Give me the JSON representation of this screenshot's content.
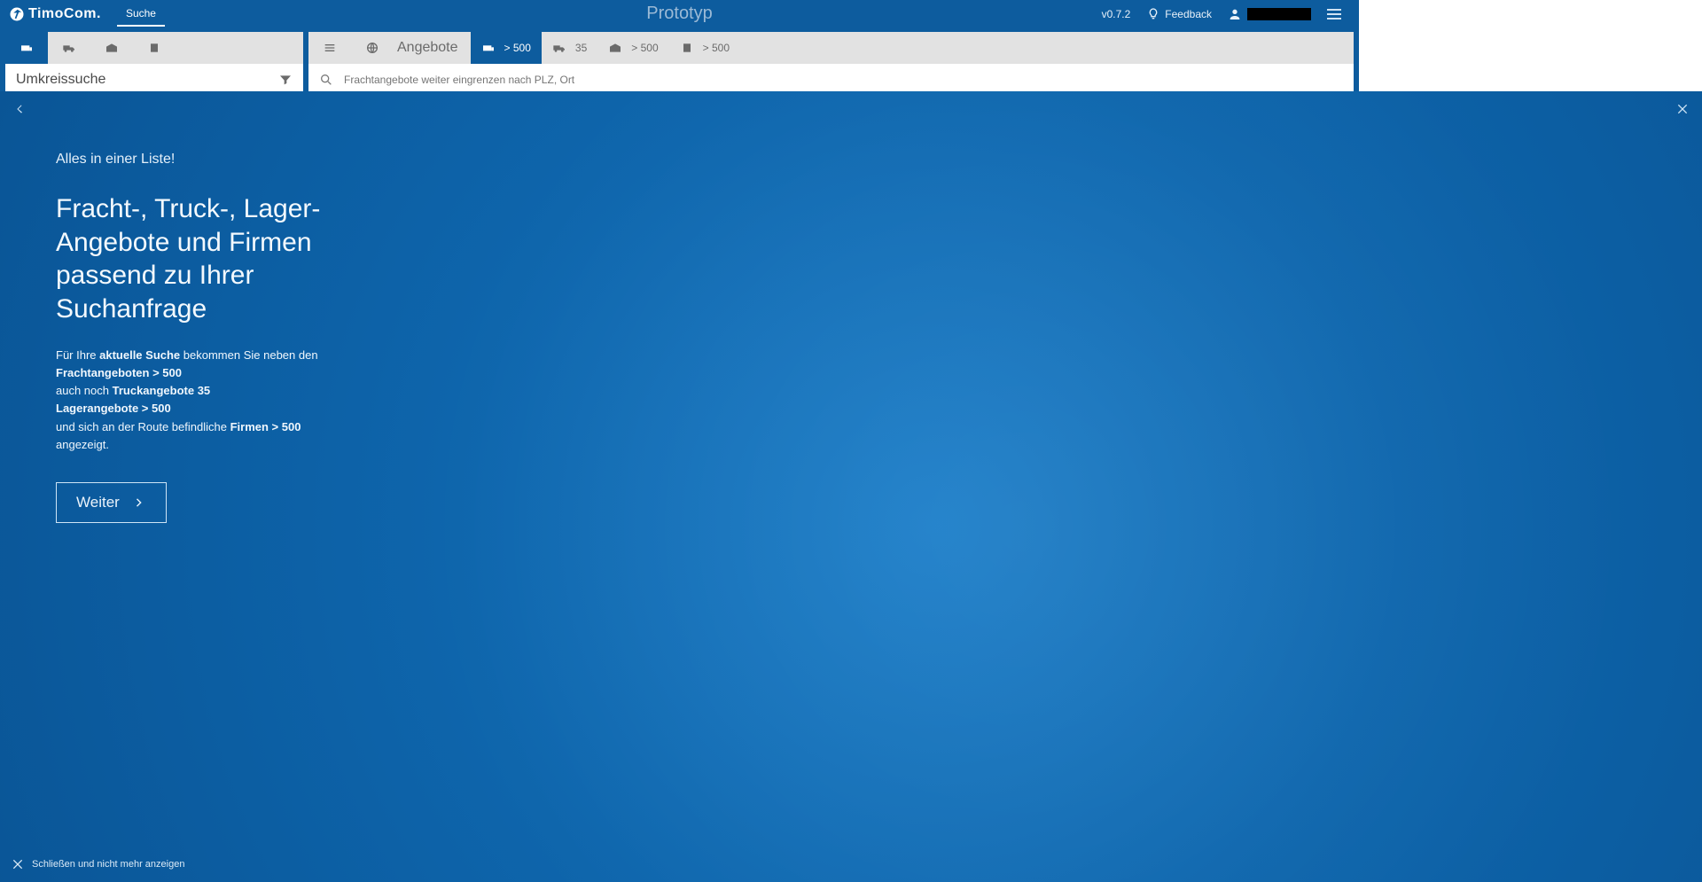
{
  "header": {
    "brand": "TimoCom.",
    "nav_tab": "Suche",
    "center_label": "Prototyp",
    "version": "v0.7.2",
    "feedback": "Feedback"
  },
  "left_panel": {
    "search_label": "Umkreissuche"
  },
  "right_panel": {
    "offers_label": "Angebote",
    "filter_placeholder": "Frachtangebote weiter eingrenzen nach PLZ, Ort",
    "tabs": [
      {
        "icon": "freight",
        "count": "> 500"
      },
      {
        "icon": "truck",
        "count": "35"
      },
      {
        "icon": "storage",
        "count": "> 500"
      },
      {
        "icon": "company",
        "count": "> 500"
      }
    ]
  },
  "overlay": {
    "kicker": "Alles in einer Liste!",
    "title": "Fracht-, Truck-, Lager-Angebote und Firmen passend zu Ihrer Suchanfrage",
    "p1a": "Für Ihre ",
    "p1b": "aktuelle Suche",
    "p1c": " bekommen Sie neben den ",
    "p1d": "Frachtangeboten > 500",
    "p2a": "auch noch ",
    "p2b": "Truckangebote 35",
    "p3": "Lagerangebote > 500",
    "p4a": "und sich an der Route befindliche ",
    "p4b": "Firmen > 500",
    "p4c": " angezeigt.",
    "cta": "Weiter",
    "dismiss": "Schließen und nicht mehr anzeigen"
  }
}
